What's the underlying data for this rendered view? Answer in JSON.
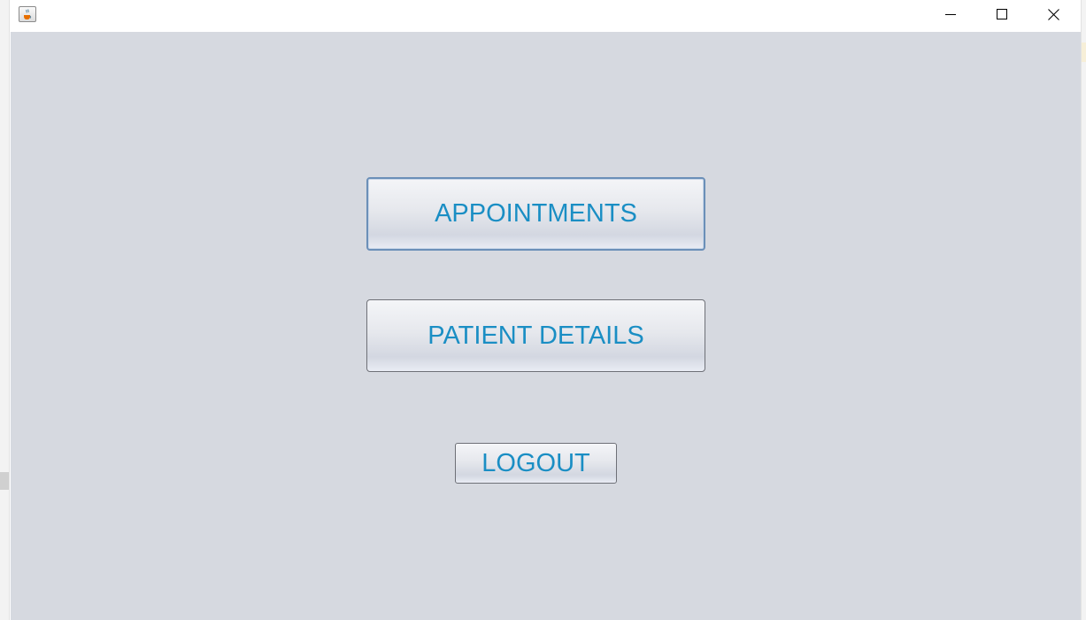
{
  "window": {
    "title": "",
    "controls": {
      "minimize": "minimize-icon",
      "maximize": "maximize-icon",
      "close": "close-icon"
    }
  },
  "menu": {
    "appointments_label": "APPOINTMENTS",
    "patient_details_label": "PATIENT DETAILS",
    "logout_label": "LOGOUT"
  },
  "colors": {
    "background": "#d6d9e0",
    "button_text": "#1a8ec4",
    "titlebar": "#ffffff"
  }
}
